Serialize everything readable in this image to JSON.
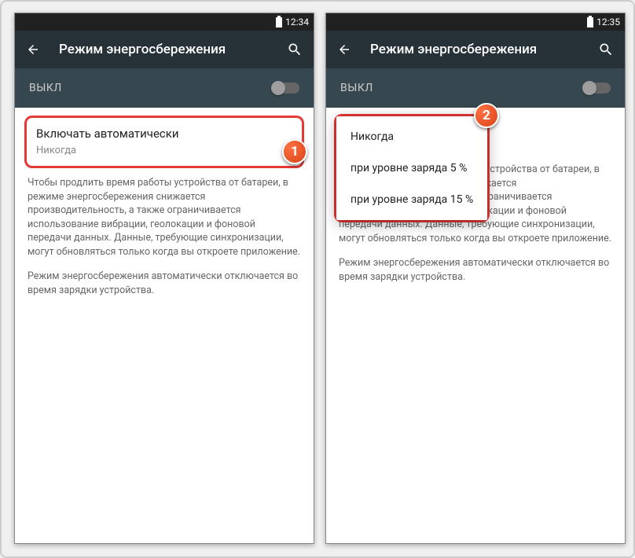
{
  "left": {
    "status_time": "12:34",
    "title": "Режим энергосбережения",
    "toggle_label": "ВЫКЛ",
    "pref_title": "Включать автоматически",
    "pref_sub": "Никогда",
    "desc1": "Чтобы продлить время работы устройства от батареи, в режиме энергосбережения снижается производительность, а также ограничивается использование вибрации, геолокации и фоновой передачи данных. Данные, требующие синхронизации, могут обновляться только когда вы откроете приложение.",
    "desc2": "Режим энергосбережения автоматически отключается во время зарядки устройства.",
    "badge": "1"
  },
  "right": {
    "status_time": "12:35",
    "title": "Режим энергосбережения",
    "toggle_label": "ВЫКЛ",
    "desc1": "Чтобы продлить время работы устройства от батареи, в режиме энергосбережения снижается производительность, а также ограничивается использование вибрации, геолокации и фоновой передачи данных. Данные, требующие синхронизации, могут обновляться только когда вы откроете приложение.",
    "desc2": "Режим энергосбережения автоматически отключается во время зарядки устройства.",
    "popup": {
      "opt1": "Никогда",
      "opt2": "при уровне заряда 5 %",
      "opt3": "при уровне заряда 15 %"
    },
    "badge": "2"
  }
}
